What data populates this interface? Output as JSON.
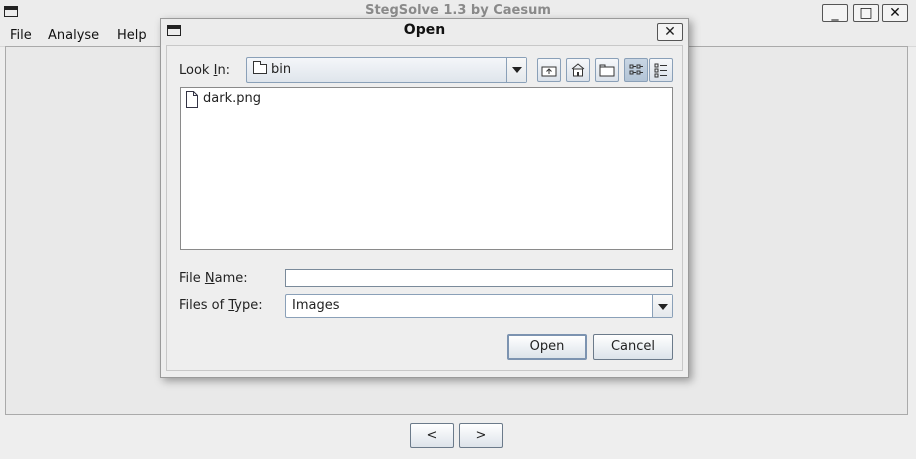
{
  "main_window": {
    "title": "StegSolve 1.3 by Caesum",
    "controls": {
      "minimize": "_",
      "maximize": "□",
      "close": "✕"
    },
    "menu": [
      "File",
      "Analyse",
      "Help"
    ],
    "nav": {
      "prev": "<",
      "next": ">"
    }
  },
  "dialog": {
    "title": "Open",
    "close": "✕",
    "look_in_label_pre": "Look ",
    "look_in_label_mn": "I",
    "look_in_label_post": "n:",
    "look_in_value": "bin",
    "toolbar_icons": [
      "up-one-level-icon",
      "home-icon",
      "new-folder-icon",
      "list-view-icon",
      "details-view-icon"
    ],
    "files": [
      {
        "name": "dark.png"
      }
    ],
    "file_name_label_pre": "File ",
    "file_name_label_mn": "N",
    "file_name_label_post": "ame:",
    "file_name_value": "",
    "files_of_type_label_pre": "Files of ",
    "files_of_type_label_mn": "T",
    "files_of_type_label_post": "ype:",
    "files_of_type_value": "Images",
    "open_button": "Open",
    "cancel_button": "Cancel"
  }
}
